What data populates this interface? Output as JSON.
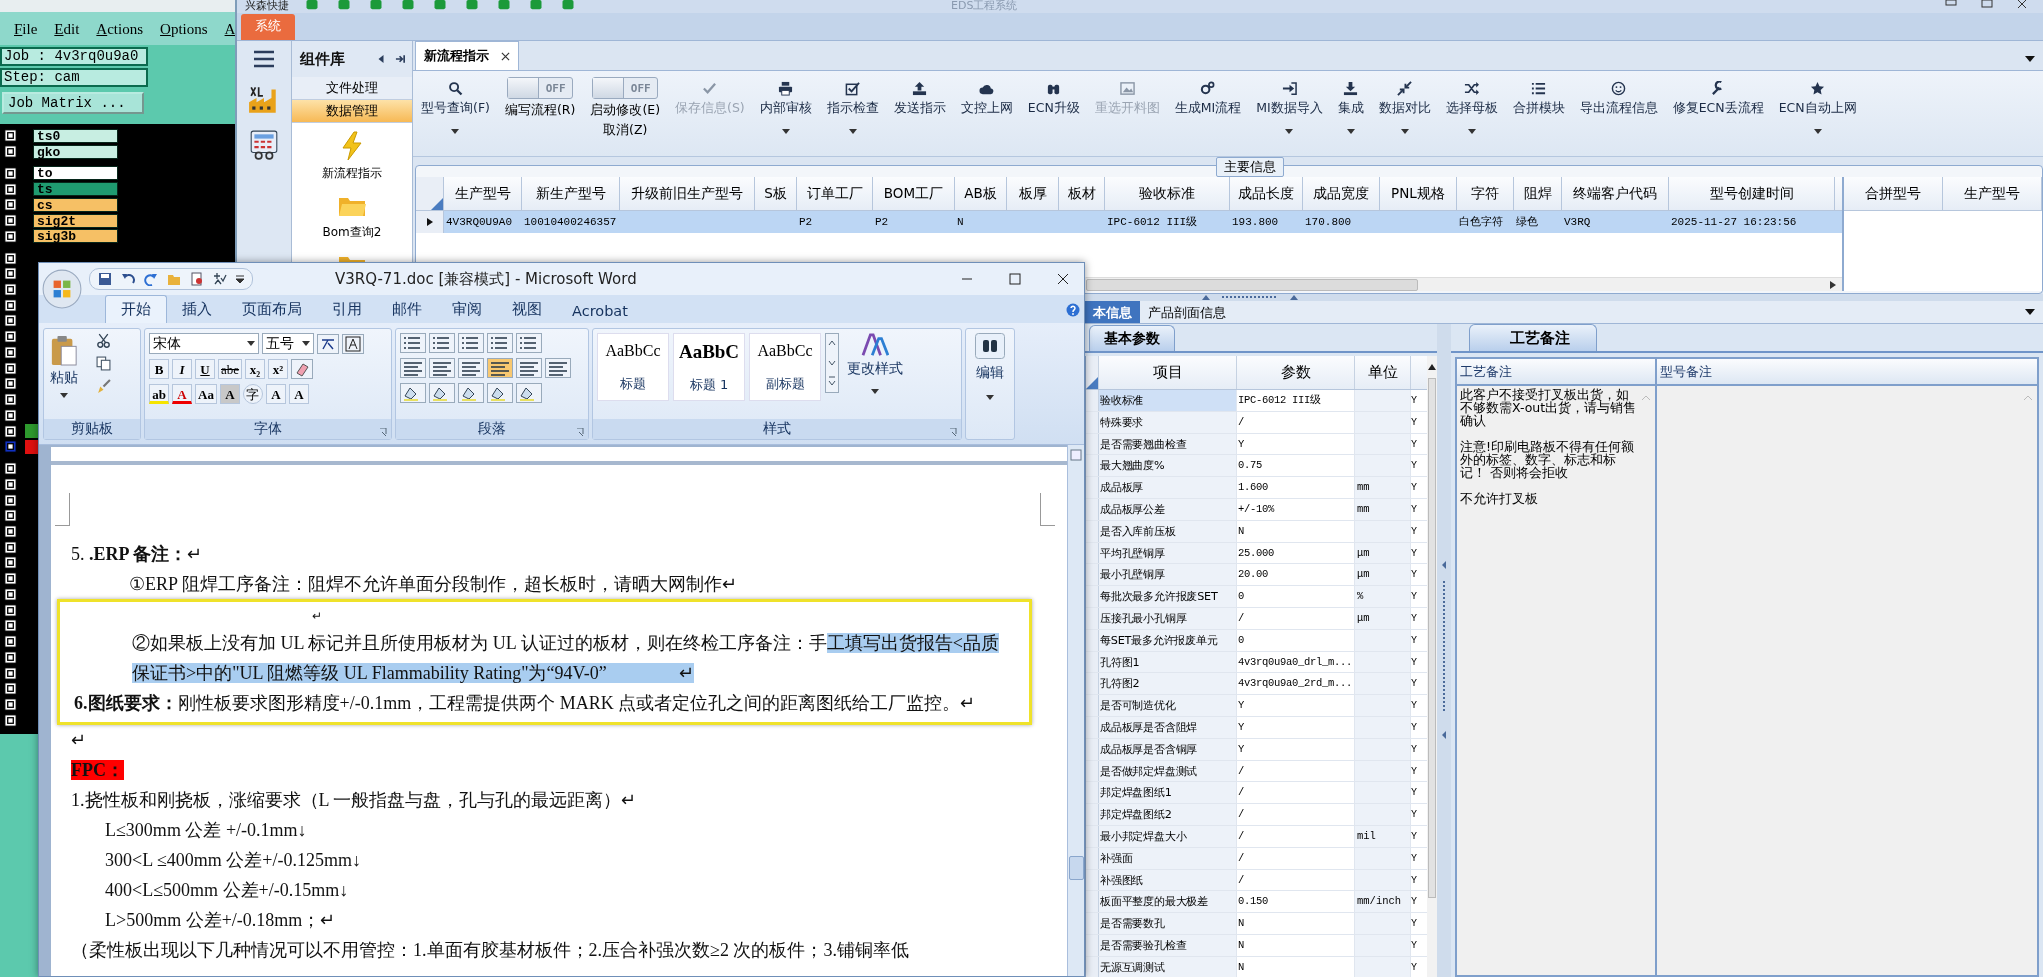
{
  "cam": {
    "menu": [
      "File",
      "Edit",
      "Actions",
      "Options",
      "A"
    ],
    "job": "Job : 4v3rq0u9a0",
    "step": "Step: cam",
    "matrix_button": "Job Matrix ...",
    "layers": [
      {
        "name": "ts0",
        "color": "#c8eee2"
      },
      {
        "name": "gko",
        "color": "#c8eee2"
      },
      {
        "name": "to",
        "color": "#ffffff"
      },
      {
        "name": "ts",
        "color": "#1f9a70"
      },
      {
        "name": "cs",
        "color": "#f6c065"
      },
      {
        "name": "sig2t",
        "color": "#f6c065"
      },
      {
        "name": "sig3b",
        "color": "#f6c065"
      }
    ]
  },
  "erp": {
    "quick_title": "兴森快捷",
    "title": "EDS工程系统",
    "system_tab": "系统",
    "component_library": {
      "title": "组件库",
      "sections": [
        {
          "label": "文件处理",
          "selected": false
        },
        {
          "label": "数据管理",
          "selected": true
        }
      ],
      "items": [
        "新流程指示",
        "Bom查询2"
      ]
    },
    "tabs": [
      {
        "label": "新流程指示",
        "selected": true
      }
    ],
    "toolbar": [
      {
        "kind": "button",
        "label": "型号查询(F)",
        "disabled": false,
        "dropdown": true
      },
      {
        "kind": "toggle",
        "label": "编写流程(R)",
        "toggle_text": "OFF",
        "on": false
      },
      {
        "kind": "toggle",
        "label": "启动修改(E)",
        "sublabel": "取消(Z)",
        "toggle_text": "OFF",
        "on": false
      },
      {
        "kind": "button",
        "label": "保存信息(S)",
        "disabled": true,
        "dropdown": false
      },
      {
        "kind": "button",
        "label": "内部审核",
        "disabled": false,
        "dropdown": true
      },
      {
        "kind": "button",
        "label": "指示检查",
        "disabled": false,
        "dropdown": true
      },
      {
        "kind": "button",
        "label": "发送指示",
        "disabled": false,
        "dropdown": false
      },
      {
        "kind": "button",
        "label": "文控上网",
        "disabled": false,
        "dropdown": false
      },
      {
        "kind": "button",
        "label": "ECN升级",
        "disabled": false,
        "dropdown": false
      },
      {
        "kind": "button",
        "label": "重选开料图",
        "disabled": true,
        "dropdown": false
      },
      {
        "kind": "button",
        "label": "生成MI流程",
        "disabled": false,
        "dropdown": false
      },
      {
        "kind": "button",
        "label": "MI数据导入",
        "disabled": false,
        "dropdown": true
      },
      {
        "kind": "button",
        "label": "集成",
        "disabled": false,
        "dropdown": true
      },
      {
        "kind": "button",
        "label": "数据对比",
        "disabled": false,
        "dropdown": true
      },
      {
        "kind": "button",
        "label": "选择母板",
        "disabled": false,
        "dropdown": true
      },
      {
        "kind": "button",
        "label": "合拼模块",
        "disabled": false,
        "dropdown": false
      },
      {
        "kind": "button",
        "label": "导出流程信息",
        "disabled": false,
        "dropdown": false
      },
      {
        "kind": "button",
        "label": "修复ECN丢流程",
        "disabled": false,
        "dropdown": false
      },
      {
        "kind": "button",
        "label": "ECN自动上网",
        "disabled": false,
        "dropdown": true
      }
    ],
    "main_info": {
      "legend": "主要信息",
      "columns": [
        "生产型号",
        "新生产型号",
        "升级前旧生产型号",
        "S板",
        "订单工厂",
        "BOM工厂",
        "AB板",
        "板厚",
        "板材",
        "验收标准",
        "成品长度",
        "成品宽度",
        "PNL规格",
        "字符",
        "阻焊",
        "终端客户代码",
        "型号创建时间"
      ],
      "rows": [
        {
          "selected": true,
          "cells": [
            "4V3RQ0U9A0",
            "10010400246357",
            null,
            null,
            "P2",
            "P2",
            "N",
            null,
            null,
            "IPC-6012 III级",
            "193.800",
            "170.800",
            null,
            "白色字符",
            "绿色",
            "V3RQ",
            "2025-11-27 16:23:56"
          ]
        }
      ],
      "side_columns": [
        "合拼型号",
        "生产型号"
      ]
    },
    "lower_tabs": [
      {
        "label": "本信息",
        "selected": true
      },
      {
        "label": "产品剖面信息",
        "selected": false
      }
    ],
    "params": {
      "tab": "基本参数",
      "columns": [
        "项目",
        "参数",
        "单位"
      ],
      "rows": [
        {
          "name": "验收标准",
          "value": "IPC-6012 III级",
          "flag": "Y",
          "selected": true
        },
        {
          "name": "特殊要求",
          "value": "/",
          "flag": "Y",
          "selected": false
        },
        {
          "name": "是否需要翘曲检查",
          "value": "Y",
          "flag": "Y",
          "selected": false
        },
        {
          "name": "最大翘曲度%",
          "value": "0.75",
          "flag": "Y",
          "selected": false
        },
        {
          "name": "成品板厚",
          "value": "1.600",
          "unit": "mm",
          "flag": "Y",
          "selected": false
        },
        {
          "name": "成品板厚公差",
          "value": "+/-10%",
          "unit": "mm",
          "flag": "Y",
          "selected": false
        },
        {
          "name": "是否入库前压板",
          "value": "N",
          "flag": "Y",
          "selected": false
        },
        {
          "name": "平均孔壁铜厚",
          "value": "25.000",
          "unit": "μm",
          "flag": "Y",
          "selected": false
        },
        {
          "name": "最小孔壁铜厚",
          "value": "20.00",
          "unit": "μm",
          "flag": "Y",
          "selected": false
        },
        {
          "name": "每批次最多允许报废SET",
          "value": "0",
          "unit": "%",
          "flag": "Y",
          "selected": false
        },
        {
          "name": "压接孔最小孔铜厚",
          "value": "/",
          "unit": "μm",
          "flag": "Y",
          "selected": false
        },
        {
          "name": "每SET最多允许报废单元",
          "value": "0",
          "flag": "Y",
          "selected": false
        },
        {
          "name": "孔符图1",
          "value": "4v3rq0u9a0_drl_m...",
          "flag": "Y",
          "selected": false
        },
        {
          "name": "孔符图2",
          "value": "4v3rq0u9a0_2rd_m...",
          "flag": "Y",
          "selected": false
        },
        {
          "name": "是否可制造优化",
          "value": "Y",
          "flag": "Y",
          "selected": false
        },
        {
          "name": "成品板厚是否含阻焊",
          "value": "Y",
          "flag": "Y",
          "selected": false
        },
        {
          "name": "成品板厚是否含铜厚",
          "value": "Y",
          "flag": "Y",
          "selected": false
        },
        {
          "name": "是否做邦定焊盘测试",
          "value": "/",
          "flag": "Y",
          "selected": false
        },
        {
          "name": "邦定焊盘图纸1",
          "value": "/",
          "flag": "Y",
          "selected": false
        },
        {
          "name": "邦定焊盘图纸2",
          "value": "/",
          "flag": "Y",
          "selected": false
        },
        {
          "name": "最小邦定焊盘大小",
          "value": "/",
          "unit": "mil",
          "flag": "Y",
          "selected": false
        },
        {
          "name": "补强面",
          "value": "/",
          "flag": "Y",
          "selected": false
        },
        {
          "name": "补强图纸",
          "value": "/",
          "flag": "Y",
          "selected": false
        },
        {
          "name": "板面平整度的最大极差",
          "value": "0.150",
          "unit": "mm/inch",
          "flag": "Y",
          "selected": false
        },
        {
          "name": "是否需要数孔",
          "value": "N",
          "flag": "Y",
          "selected": false
        },
        {
          "name": "是否需要验孔检查",
          "value": "N",
          "flag": "Y",
          "selected": false
        },
        {
          "name": "无源互调测试",
          "value": "N",
          "flag": "Y",
          "selected": false
        }
      ]
    },
    "notes": {
      "tab": "工艺备注",
      "columns": [
        "工艺备注",
        "型号备注"
      ],
      "process_notes": [
        "此客户不接受打叉板出货，如不够数需X-out出货，请与销售确认",
        "注意!印刷电路板不得有任何额外的标签、数字、标志和标记！ 否则将会拒收",
        "不允许打叉板"
      ]
    }
  },
  "word": {
    "title": "V3RQ-71.doc [兼容模式] - Microsoft Word",
    "tabs": [
      {
        "label": "开始",
        "selected": true
      },
      {
        "label": "插入",
        "selected": false
      },
      {
        "label": "页面布局",
        "selected": false
      },
      {
        "label": "引用",
        "selected": false
      },
      {
        "label": "邮件",
        "selected": false
      },
      {
        "label": "审阅",
        "selected": false
      },
      {
        "label": "视图",
        "selected": false
      },
      {
        "label": "Acrobat",
        "selected": false
      }
    ],
    "ribbon": {
      "clipboard": "剪贴板",
      "paste": "粘贴",
      "font_group": "字体",
      "font_face": "宋体",
      "font_size": "五号",
      "font_row": [
        "B",
        "I",
        "U",
        "abe",
        "x₂",
        "x²"
      ],
      "font_row2": [
        "ab",
        "A",
        "Aa",
        "A",
        "字",
        "A",
        "A"
      ],
      "paragraph_group": "段落",
      "styles_group": "样式",
      "styles": [
        {
          "sample": "AaBbCc",
          "name": "标题"
        },
        {
          "sample": "AaBbC",
          "name": "标题 1"
        },
        {
          "sample": "AaBbCc",
          "name": "副标题"
        }
      ],
      "change_styles": "更改样式",
      "editing": "编辑"
    },
    "document": {
      "before": [
        {
          "kind": "plain",
          "parts": [
            {
              "text": "5. **.ERP 备注：**↵",
              "selected": false
            }
          ]
        },
        {
          "kind": "indent",
          "parts": [
            {
              "text": "①ERP 阻焊工序备注：阻焊不允许单面分段制作，超长板时，请晒大网制作↵",
              "selected": false
            }
          ]
        }
      ],
      "framed": [
        {
          "kind": "mark",
          "parts": [
            {
              "text": "↵",
              "selected": false
            }
          ]
        },
        {
          "kind": "indent",
          "parts": [
            {
              "text": "②如果板上没有加 UL 标记并且所使用板材为 UL 认证过的板材，则在终检工序备注：手",
              "selected": false
            },
            {
              "text": "工填写出货报告<品质保证书>中的\"UL 阻燃等级 UL Flammability Rating\"为“94V-0”　　　　↵",
              "selected": true
            }
          ]
        },
        {
          "kind": "plain",
          "parts": [
            {
              "text": "**6.图纸要求：**刚性板要求图形精度+/-0.1mm，工程需提供两个 MARK 点或者定位孔之间的距离图纸给工厂监控。↵",
              "selected": false
            }
          ]
        }
      ],
      "after": [
        {
          "kind": "plain",
          "parts": [
            {
              "text": "↵",
              "selected": false
            }
          ]
        },
        {
          "kind": "marker",
          "parts": [
            {
              "text": "FPC：",
              "selected": false
            }
          ]
        },
        {
          "kind": "plain",
          "parts": [
            {
              "text": "1.挠性板和刚挠板，涨缩要求（L 一般指盘与盘，孔与孔的最远距离）↵",
              "selected": false
            }
          ]
        },
        {
          "kind": "sub",
          "parts": [
            {
              "text": "L≤300mm 公差 +/-0.1mm↓",
              "selected": false
            }
          ]
        },
        {
          "kind": "sub",
          "parts": [
            {
              "text": "300<L ≤400mm 公差+/-0.125mm↓",
              "selected": false
            }
          ]
        },
        {
          "kind": "sub",
          "parts": [
            {
              "text": "400<L≤500mm 公差+/-0.15mm↓",
              "selected": false
            }
          ]
        },
        {
          "kind": "sub",
          "parts": [
            {
              "text": "L>500mm 公差+/-0.18mm；↵",
              "selected": false
            }
          ]
        },
        {
          "kind": "plain",
          "parts": [
            {
              "text": "（柔性板出现以下几种情况可以不用管控：1.单面有胶基材板件；2.压合补强次数≥2 次的板件；3.铺铜率低",
              "selected": false
            }
          ]
        }
      ]
    }
  }
}
